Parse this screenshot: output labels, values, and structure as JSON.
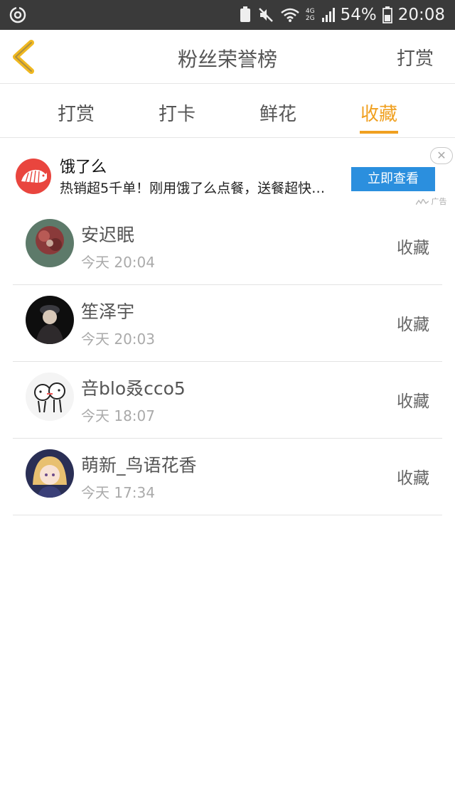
{
  "status_bar": {
    "battery": "54%",
    "time": "20:08",
    "network_top": "4G",
    "network_bottom": "2G"
  },
  "header": {
    "title": "粉丝荣誉榜",
    "right_action": "打赏"
  },
  "tabs": [
    {
      "label": "打赏",
      "active": false
    },
    {
      "label": "打卡",
      "active": false
    },
    {
      "label": "鲜花",
      "active": false
    },
    {
      "label": "收藏",
      "active": true
    }
  ],
  "ad": {
    "title": "饿了么",
    "description": "热销超5千单！刚用饿了么点餐，送餐超快…",
    "button": "立即查看",
    "close": "✕",
    "tag": "广告"
  },
  "fans": [
    {
      "name": "安迟眠",
      "time": "今天 20:04",
      "action": "收藏"
    },
    {
      "name": "笙泽宇",
      "time": "今天 20:03",
      "action": "收藏"
    },
    {
      "name": "咅blo叒cco5",
      "time": "今天 18:07",
      "action": "收藏"
    },
    {
      "name": "萌新_鸟语花香",
      "time": "今天 17:34",
      "action": "收藏"
    }
  ],
  "colors": {
    "accent": "#f0a020",
    "ad_button": "#2b8fde",
    "ad_logo": "#e9453e",
    "status_bar": "#3a3a3a"
  }
}
